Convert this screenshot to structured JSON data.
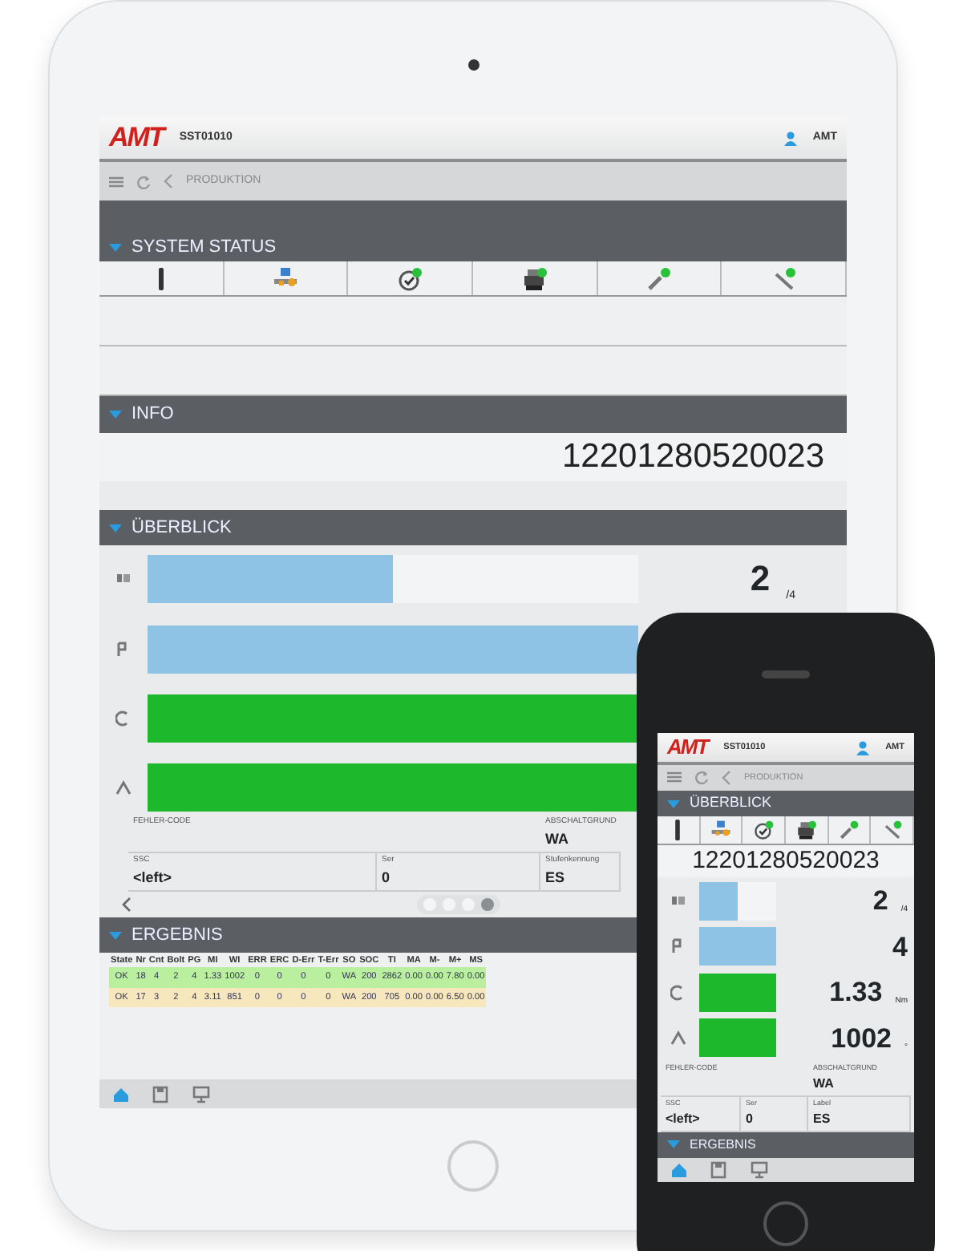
{
  "tablet": {
    "logo": "AMT",
    "station": "SST01010",
    "user": "AMT",
    "breadcrumb": "PRODUKTION",
    "system_status": {
      "title": "SYSTEM STATUS"
    },
    "info": {
      "title": "INFO",
      "value": "12201280520023"
    },
    "overview": {
      "title": "ÜBERBLICK",
      "count": "2",
      "total": "/4",
      "bars": [
        {
          "color": "#8fc3e6",
          "level": 0.5
        },
        {
          "color": "#8fc3e6",
          "level": 1
        },
        {
          "color": "#1db82c",
          "level": 1
        },
        {
          "color": "#1db82c",
          "level": 1
        }
      ],
      "fields": [
        {
          "label": "FEHLER-CODE"
        },
        {
          "label": "ABSCHALTGRUND",
          "value": "WA"
        },
        {
          "label": "SSC",
          "value": "<left>"
        },
        {
          "label": "Ser",
          "value": "0"
        },
        {
          "label": "Stufenkennung",
          "value": "ES"
        }
      ],
      "pages": [
        {
          "selected": false
        },
        {
          "selected": false
        },
        {
          "selected": false
        },
        {
          "selected": true
        }
      ]
    },
    "result": {
      "title": "ERGEBNIS",
      "columns": [
        "State",
        "Nr",
        "Cnt",
        "Bolt",
        "PG",
        "MI",
        "WI",
        "ERR",
        "ERC",
        "D-Err",
        "T-Err",
        "SO",
        "SOC",
        "TI",
        "MA",
        "M-",
        "M+",
        "MS"
      ],
      "rows": [
        {
          "color": "#b9ef9f",
          "cells": [
            "OK",
            "18",
            "4",
            "2",
            "4",
            "1.33",
            "1002",
            "0",
            "0",
            "0",
            "0",
            "WA",
            "200",
            "2862",
            "0.00",
            "0.00",
            "7.80",
            "0.00"
          ]
        },
        {
          "color": "#f6e7bd",
          "cells": [
            "OK",
            "17",
            "3",
            "2",
            "4",
            "3.11",
            "851",
            "0",
            "0",
            "0",
            "0",
            "WA",
            "200",
            "705",
            "0.00",
            "0.00",
            "6.50",
            "0.00"
          ]
        }
      ]
    },
    "bottom_tabs": [
      {
        "kind": "home",
        "selected": true
      },
      {
        "kind": "save",
        "selected": false
      },
      {
        "kind": "monitor",
        "selected": false
      }
    ]
  },
  "phone": {
    "logo": "AMT",
    "station": "SST01010",
    "user": "AMT",
    "breadcrumb": "PRODUKTION",
    "overview": {
      "title": "ÜBERBLICK",
      "info_value": "12201280520023",
      "gauges": [
        {
          "color": "#8fc3e6",
          "level": 0.5,
          "value": "2",
          "unit": "/4"
        },
        {
          "color": "#8fc3e6",
          "level": 1,
          "value": "4"
        },
        {
          "color": "#1db82c",
          "level": 1,
          "value": "1.33",
          "unit": "Nm"
        },
        {
          "color": "#1db82c",
          "level": 1,
          "value": "1002",
          "unit": "°"
        }
      ],
      "fields": [
        {
          "label": "FEHLER-CODE"
        },
        {
          "label": "ABSCHALTGRUND",
          "value": "WA"
        },
        {
          "label": "SSC",
          "value": "<left>"
        },
        {
          "label": "Ser",
          "value": "0"
        },
        {
          "label": "Label",
          "value": "ES"
        }
      ]
    },
    "result": {
      "title": "ERGEBNIS"
    },
    "bottom_tabs": [
      {
        "kind": "home",
        "selected": true
      },
      {
        "kind": "save",
        "selected": false
      },
      {
        "kind": "monitor",
        "selected": false
      }
    ]
  }
}
